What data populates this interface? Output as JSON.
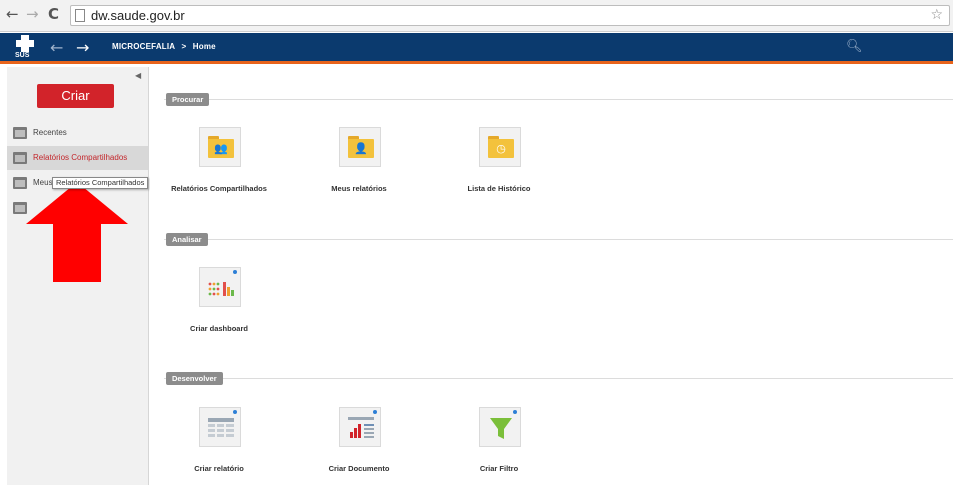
{
  "browser": {
    "url": "dw.saude.gov.br",
    "back_glyph": "←",
    "forward_glyph": "→",
    "reload_glyph": "C",
    "star_glyph": "☆"
  },
  "header": {
    "logo_text": "SUS",
    "breadcrumb": [
      "MICROCEFALIA",
      "Home"
    ],
    "breadcrumb_separator": ">",
    "colors": {
      "bar": "#0b3a6e",
      "accent": "#e8641b"
    }
  },
  "sidebar": {
    "collapse_glyph": "◀",
    "create_label": "Criar",
    "create_color": "#d2232a",
    "items": [
      {
        "label": "Recentes",
        "icon": "folder-recent-icon"
      },
      {
        "label": "Relatórios Compartilhados",
        "icon": "folder-shared-icon"
      },
      {
        "label": "Meus relatórios",
        "icon": "folder-user-icon"
      },
      {
        "label": "Lista de Histórico",
        "icon": "history-icon"
      }
    ],
    "tooltip": "Relatórios Compartilhados"
  },
  "sections": [
    {
      "label": "Procurar",
      "tiles": [
        {
          "label": "Relatórios Compartilhados",
          "icon": "shared-folder-icon",
          "glyph": "👥"
        },
        {
          "label": "Meus relatórios",
          "icon": "user-folder-icon",
          "glyph": "👤"
        },
        {
          "label": "Lista de Histórico",
          "icon": "history-folder-icon",
          "glyph": "◷"
        }
      ]
    },
    {
      "label": "Analisar",
      "tiles": [
        {
          "label": "Criar dashboard",
          "icon": "dashboard-icon"
        }
      ]
    },
    {
      "label": "Desenvolver",
      "tiles": [
        {
          "label": "Criar relatório",
          "icon": "report-icon"
        },
        {
          "label": "Criar Documento",
          "icon": "document-icon"
        },
        {
          "label": "Criar Filtro",
          "icon": "filter-icon"
        }
      ]
    }
  ]
}
